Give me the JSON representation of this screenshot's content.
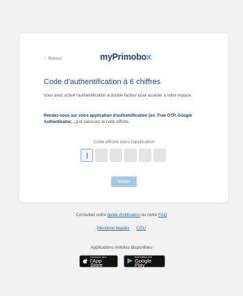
{
  "header": {
    "back_label": "Retour",
    "logo_main": "myPrimobo",
    "logo_accent": "x"
  },
  "main": {
    "title": "Code d'authentification à 6 chiffres",
    "intro": "Vous avez activé l'authentification à double facteur pour accéder à votre espace.",
    "instruction_bold": "Rendez-vous sur votre application d'authentification (ex: Free OTP, Google Authenticator, ...)",
    "instruction_rest": " et saisissez le code affiché.",
    "code_label": "Code affiché dans l'application",
    "code_digits": [
      "",
      "",
      "",
      "",
      "",
      ""
    ],
    "validate_label": "Valider"
  },
  "footer": {
    "consult_prefix": "Consultez notre ",
    "guide_link": "guide d'utilisation",
    "consult_middle": " ou notre ",
    "faq_link": "FAQ",
    "legal_link": "Mentions légales",
    "cgu_link": "CGU",
    "apps_label": "Applications mobiles disponibles",
    "apple_small": "Télécharger dans",
    "apple_big": "l'App Store",
    "google_small": "DISPONIBLE SUR",
    "google_big": "Google Play"
  },
  "colors": {
    "accent": "#1f3b78",
    "logo_accent": "#2aa6d6",
    "button": "#a5c7e8",
    "link": "#2a6bb0"
  }
}
